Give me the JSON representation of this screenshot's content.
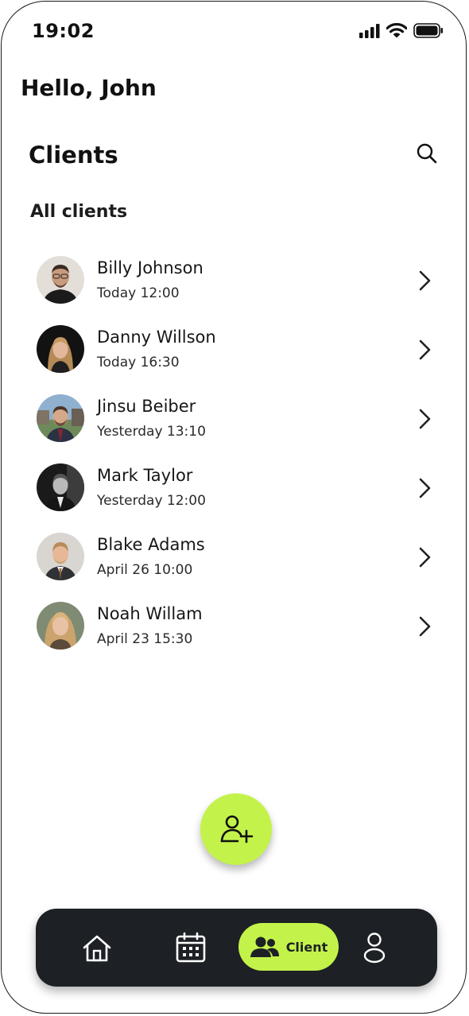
{
  "status_bar": {
    "time": "19:02"
  },
  "header": {
    "greeting": "Hello, John"
  },
  "clients_section": {
    "title": "Clients",
    "subtitle": "All clients",
    "items": [
      {
        "name": "Billy Johnson",
        "time": "Today 12:00"
      },
      {
        "name": "Danny Willson",
        "time": "Today 16:30"
      },
      {
        "name": "Jinsu Beiber",
        "time": "Yesterday 13:10"
      },
      {
        "name": "Mark Taylor",
        "time": "Yesterday 12:00"
      },
      {
        "name": "Blake Adams",
        "time": "April 26 10:00"
      },
      {
        "name": "Noah Willam",
        "time": "April 23 15:30"
      }
    ]
  },
  "tabbar": {
    "items": [
      {
        "icon": "home-icon"
      },
      {
        "icon": "calendar-icon"
      },
      {
        "icon": "users-icon",
        "label": "Client",
        "active": true
      },
      {
        "icon": "profile-icon"
      }
    ]
  },
  "fab": {
    "icon": "add-user-icon"
  },
  "colors": {
    "accent": "#c3f34a",
    "tabbar_bg": "#1d2125",
    "text": "#121212"
  }
}
